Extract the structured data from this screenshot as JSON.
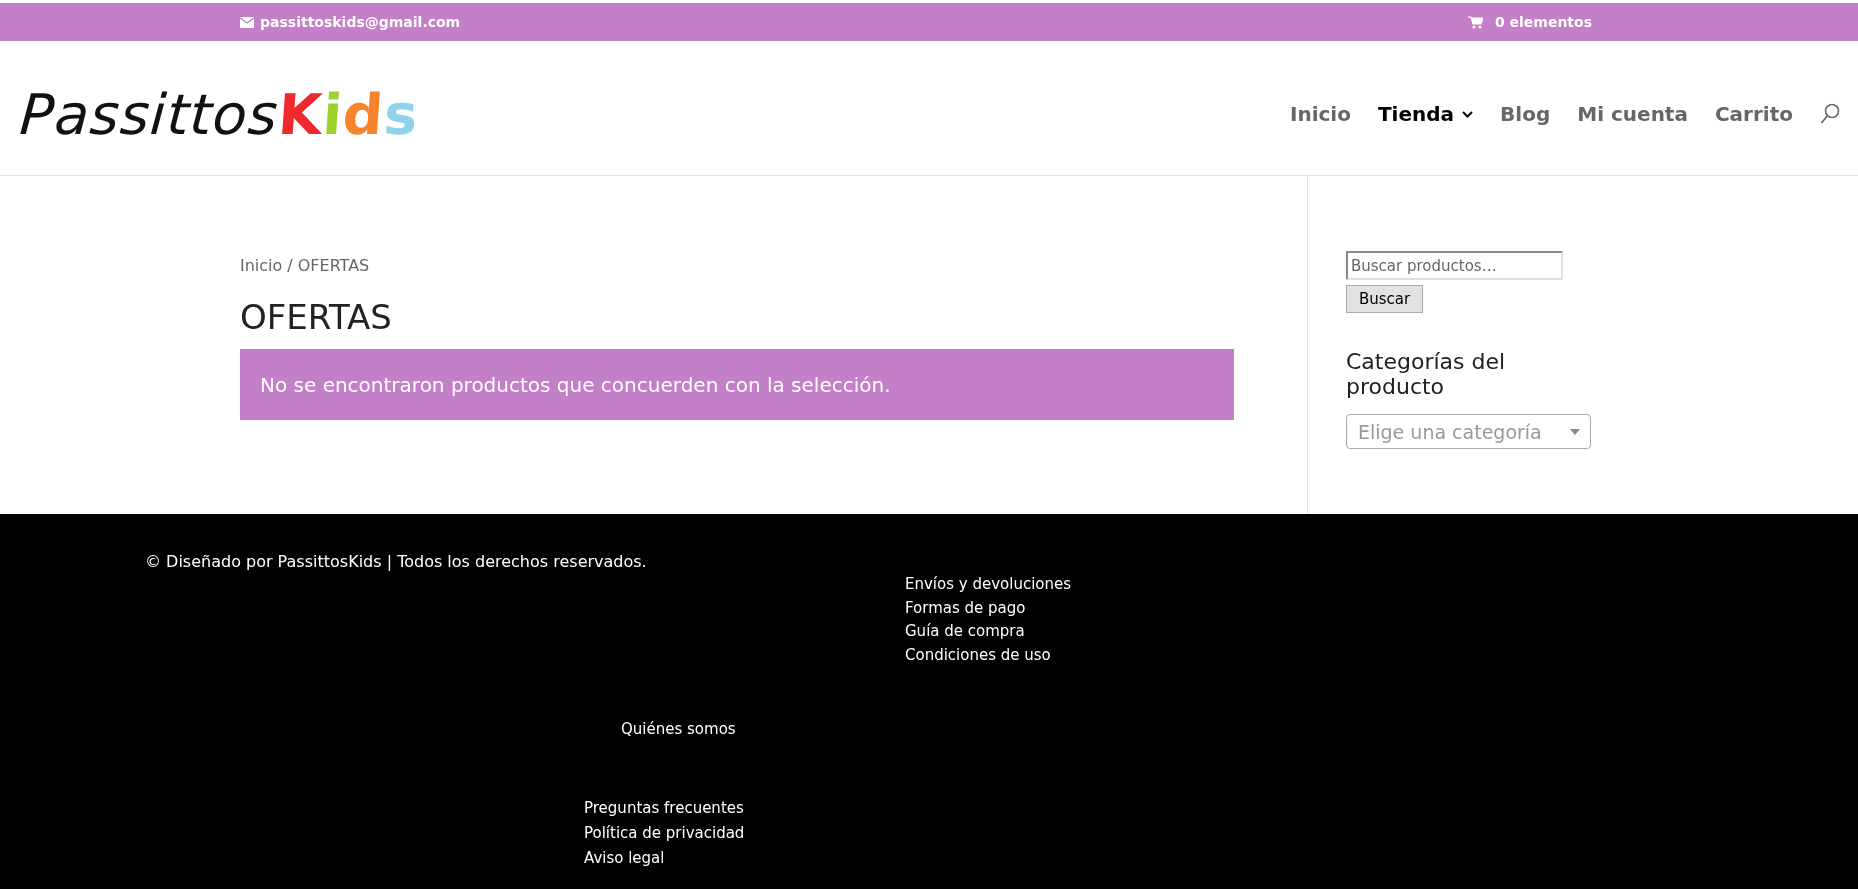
{
  "top_bar": {
    "email": "passittoskids@gmail.com",
    "cart": "0 elementos"
  },
  "logo": {
    "text": "Passittos",
    "letters": [
      {
        "char": "K",
        "color": "#ee2a2f"
      },
      {
        "char": "i",
        "color": "#9ed12a"
      },
      {
        "char": "d",
        "color": "#f7842a"
      },
      {
        "char": "s",
        "color": "#8fd3ea"
      }
    ]
  },
  "nav": {
    "items": [
      {
        "label": "Inicio",
        "selected": false,
        "has_submenu": false
      },
      {
        "label": "Tienda",
        "selected": true,
        "has_submenu": true
      },
      {
        "label": "Blog",
        "selected": false,
        "has_submenu": false
      },
      {
        "label": "Mi cuenta",
        "selected": false,
        "has_submenu": false
      },
      {
        "label": "Carrito",
        "selected": false,
        "has_submenu": false
      }
    ]
  },
  "breadcrumb": [
    "Inicio",
    "OFERTAS"
  ],
  "breadcrumb_separator": "/",
  "page_title": "OFERTAS",
  "notice": "No se encontraron productos que concuerden con la selección.",
  "sidebar": {
    "search": {
      "placeholder": "Buscar productos…",
      "button": "Buscar"
    },
    "categories_title": "Categorías del producto",
    "category_select": {
      "placeholder": "Elige una categoría"
    }
  },
  "footer": {
    "copyright": "© Diseñado por PassittosKids | Todos los derechos reservados.",
    "links_right": [
      "Envíos y devoluciones",
      "Formas de pago",
      "Guía de compra",
      "Condiciones de uso"
    ],
    "link_middle": "Quiénes somos",
    "links_left": [
      "Preguntas frecuentes",
      "Política de privacidad",
      "Aviso legal"
    ]
  }
}
